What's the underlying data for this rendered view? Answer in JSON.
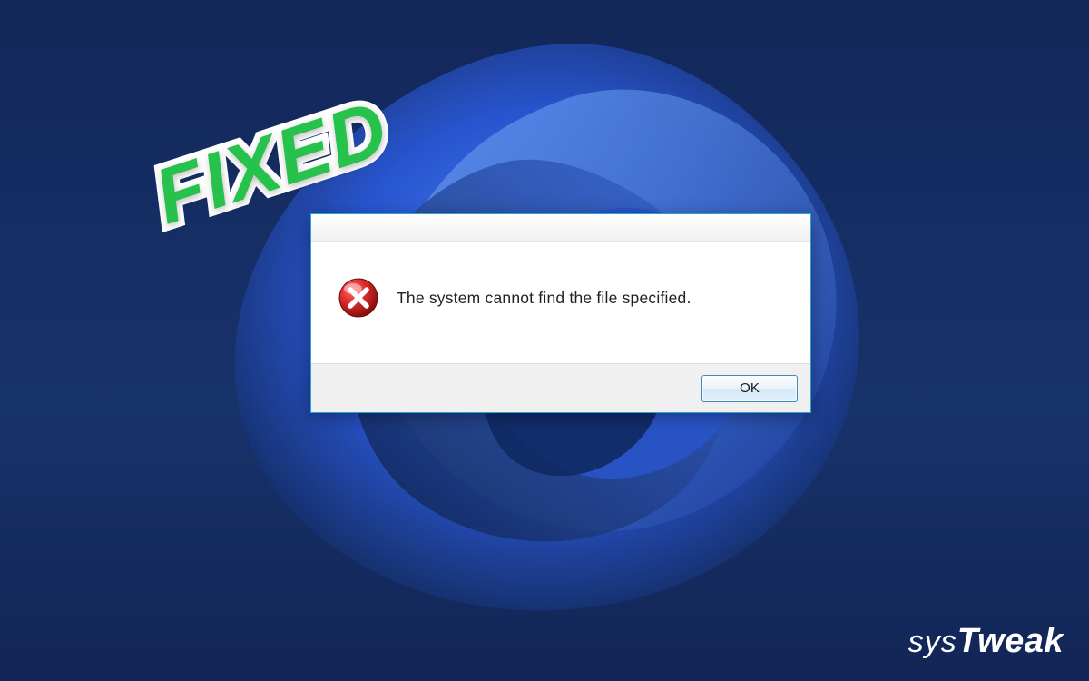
{
  "dialog": {
    "message": "The system cannot find the file specified.",
    "ok_label": "OK"
  },
  "sticker": {
    "text": "FIXED"
  },
  "brand": {
    "part1": "SYS",
    "part2": "Tweak"
  },
  "colors": {
    "accent_green": "#27c24c",
    "dialog_border": "#2aa2d3",
    "bg_deep": "#122759"
  }
}
